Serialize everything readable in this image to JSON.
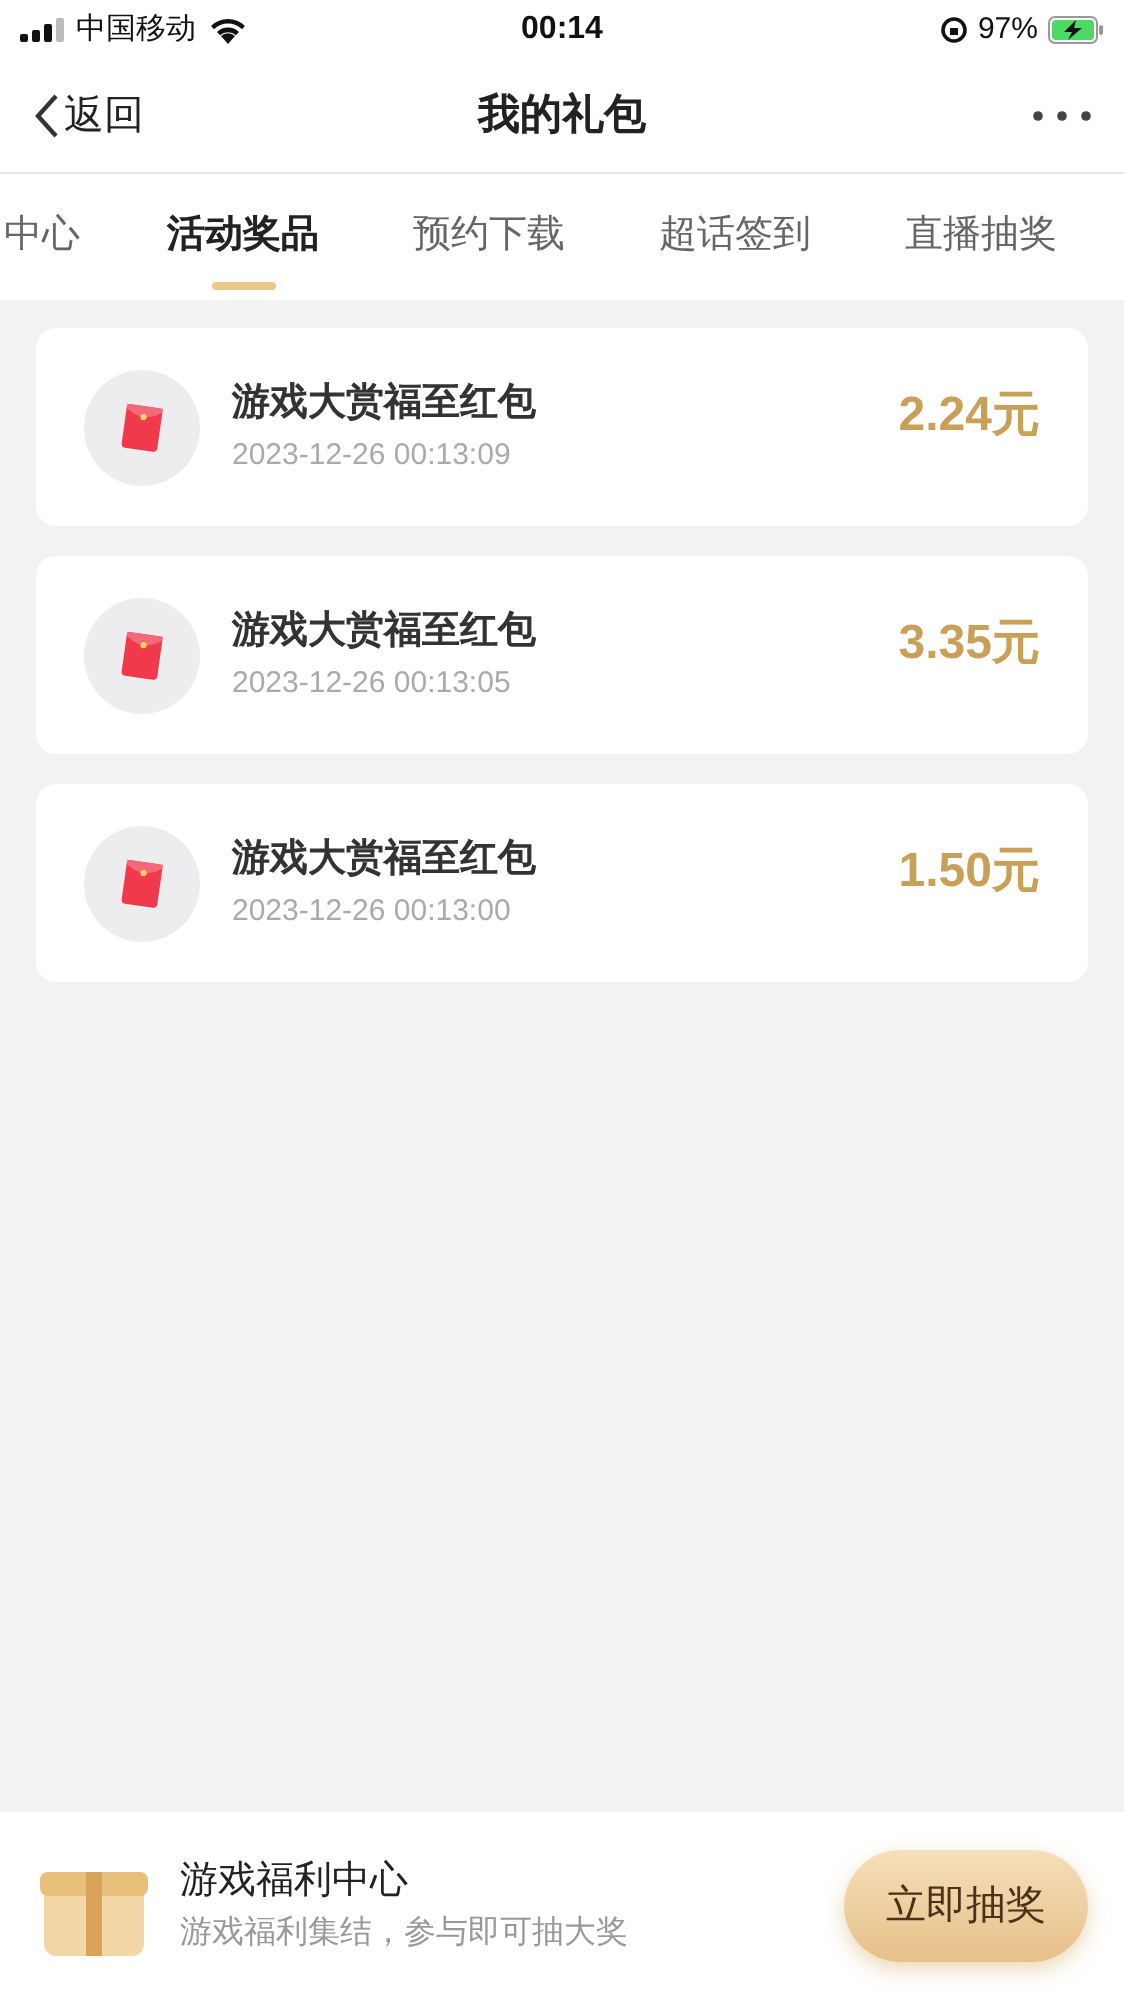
{
  "status_bar": {
    "carrier": "中国移动",
    "time": "00:14",
    "battery": "97%"
  },
  "nav": {
    "back": "返回",
    "title": "我的礼包"
  },
  "tabs": [
    {
      "label": "中心",
      "selected": false
    },
    {
      "label": "活动奖品",
      "selected": true
    },
    {
      "label": "预约下载",
      "selected": false
    },
    {
      "label": "超话签到",
      "selected": false
    },
    {
      "label": "直播抽奖",
      "selected": false
    }
  ],
  "prizes": [
    {
      "name": "游戏大赏福至红包",
      "time": "2023-12-26 00:13:09",
      "amount": "2.24元"
    },
    {
      "name": "游戏大赏福至红包",
      "time": "2023-12-26 00:13:05",
      "amount": "3.35元"
    },
    {
      "name": "游戏大赏福至红包",
      "time": "2023-12-26 00:13:00",
      "amount": "1.50元"
    }
  ],
  "banner": {
    "title": "游戏福利中心",
    "subtitle": "游戏福利集结，参与即可抽大奖",
    "button": "立即抽奖"
  }
}
